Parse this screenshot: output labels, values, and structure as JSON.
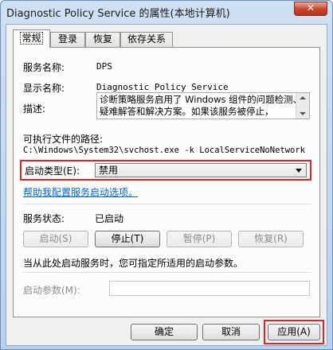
{
  "window": {
    "title": "Diagnostic Policy Service 的属性(本地计算机)",
    "close_label": "✕"
  },
  "tabs": [
    {
      "label": "常规",
      "active": true
    },
    {
      "label": "登录",
      "active": false
    },
    {
      "label": "恢复",
      "active": false
    },
    {
      "label": "依存关系",
      "active": false
    }
  ],
  "general": {
    "service_name_label": "服务名称:",
    "service_name_value": "DPS",
    "display_name_label": "显示名称:",
    "display_name_value": "Diagnostic Policy Service",
    "description_label": "描述:",
    "description_value": "诊断策略服务启用了 Windows 组件的问题检测、疑难解答和解决方案。如果该服务被停止，",
    "exe_path_label": "可执行文件的路径:",
    "exe_path_value": "C:\\Windows\\System32\\svchost.exe -k LocalServiceNoNetwork",
    "startup_type_label": "启动类型(E):",
    "startup_type_value": "禁用",
    "help_link": "帮助我配置服务启动选项。",
    "service_status_label": "服务状态:",
    "service_status_value": "已启动",
    "start_button": "启动(S)",
    "stop_button": "停止(T)",
    "pause_button": "暂停(P)",
    "resume_button": "恢复(R)",
    "start_params_hint": "当从此处启动服务时，您可指定所适用的启动参数。",
    "start_params_label": "启动参数(M):",
    "start_params_value": ""
  },
  "footer": {
    "ok_button": "确定",
    "cancel_button": "取消",
    "apply_button": "应用(A)"
  },
  "colors": {
    "highlight": "#d9262a",
    "link": "#0066cc"
  }
}
